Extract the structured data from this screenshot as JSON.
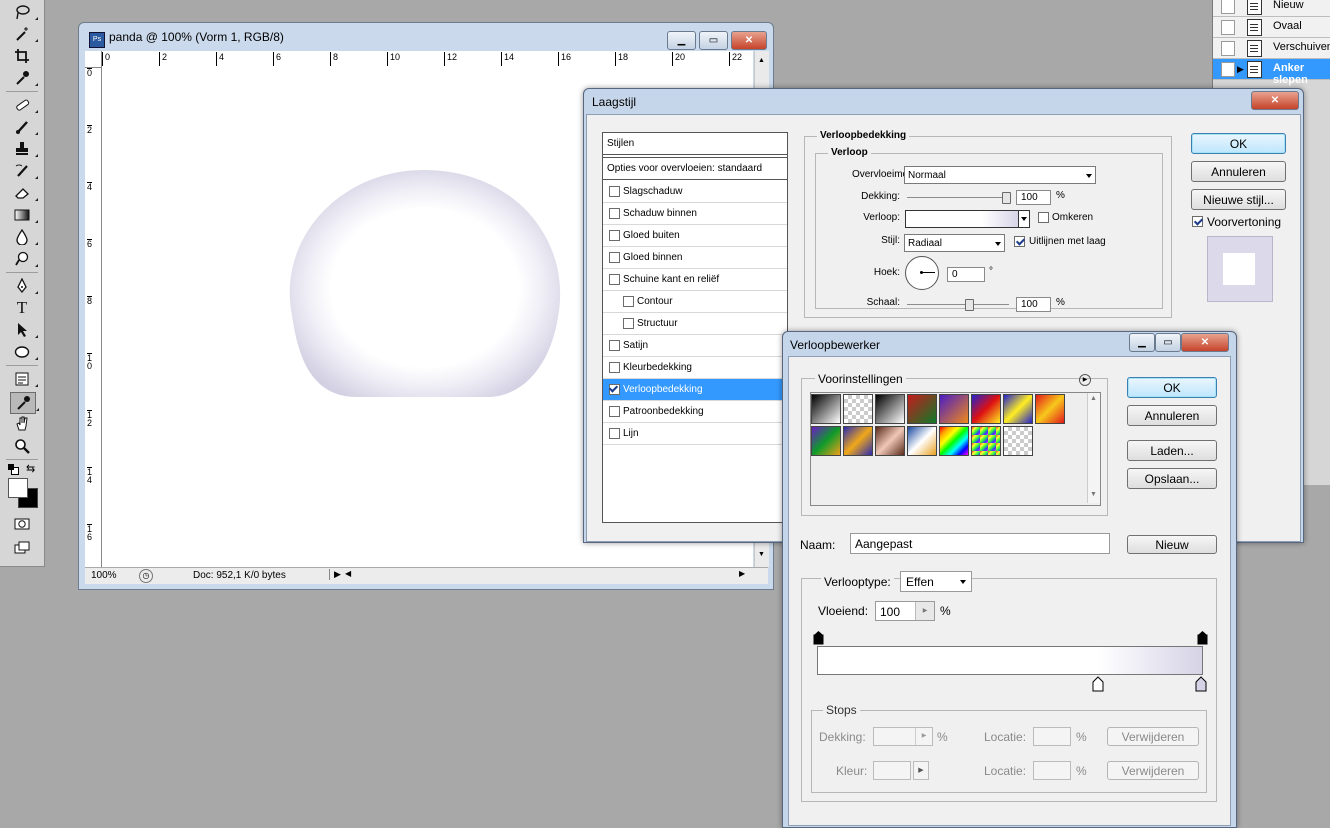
{
  "tools": {
    "icons": [
      "lasso-icon",
      "magic-wand-icon",
      "crop-icon",
      "eyedropper-icon",
      "healing-brush-icon",
      "brush-icon",
      "clone-stamp-icon",
      "history-brush-icon",
      "eraser-icon",
      "gradient-icon",
      "blur-icon",
      "dodge-icon",
      "pen-icon",
      "type-icon",
      "path-selection-icon",
      "ellipse-icon",
      "notes-icon",
      "eyedropper-active-icon",
      "hand-icon",
      "zoom-icon"
    ],
    "type_glyph": "T"
  },
  "history": {
    "items": [
      {
        "label": "Nieuw",
        "selected": false
      },
      {
        "label": "Ovaal",
        "selected": false
      },
      {
        "label": "Verschuiven",
        "selected": false
      },
      {
        "label": "Anker slepen",
        "selected": true
      }
    ]
  },
  "document": {
    "title": "panda @ 100% (Vorm 1, RGB/8)",
    "ruler_top": [
      "0",
      "2",
      "4",
      "6",
      "8",
      "10",
      "12",
      "14",
      "16",
      "18",
      "20",
      "22"
    ],
    "ruler_left": [
      "0",
      "2",
      "4",
      "6",
      "8",
      "1\n0",
      "1\n2",
      "1\n4",
      "1\n6"
    ],
    "zoom": "100%",
    "doc_info": "Doc: 952,1 K/0 bytes"
  },
  "laagstijl": {
    "title": "Laagstijl",
    "styles_header": "Stijlen",
    "blending_options": "Opties voor overvloeien: standaard",
    "styles": [
      {
        "label": "Slagschaduw",
        "checked": false,
        "indent": false,
        "selected": false
      },
      {
        "label": "Schaduw binnen",
        "checked": false,
        "indent": false,
        "selected": false
      },
      {
        "label": "Gloed buiten",
        "checked": false,
        "indent": false,
        "selected": false
      },
      {
        "label": "Gloed binnen",
        "checked": false,
        "indent": false,
        "selected": false
      },
      {
        "label": "Schuine kant en reliëf",
        "checked": false,
        "indent": false,
        "selected": false
      },
      {
        "label": "Contour",
        "checked": false,
        "indent": true,
        "selected": false
      },
      {
        "label": "Structuur",
        "checked": false,
        "indent": true,
        "selected": false
      },
      {
        "label": "Satijn",
        "checked": false,
        "indent": false,
        "selected": false
      },
      {
        "label": "Kleurbedekking",
        "checked": false,
        "indent": false,
        "selected": false
      },
      {
        "label": "Verloopbedekking",
        "checked": true,
        "indent": false,
        "selected": true
      },
      {
        "label": "Patroonbedekking",
        "checked": false,
        "indent": false,
        "selected": false
      },
      {
        "label": "Lijn",
        "checked": false,
        "indent": false,
        "selected": false
      }
    ],
    "section_title": "Verloopbedekking",
    "group_title": "Verloop",
    "blend_mode_label": "Overvloeimodus:",
    "blend_mode_value": "Normaal",
    "opacity_label": "Dekking:",
    "opacity_value": "100",
    "opacity_unit": "%",
    "gradient_label": "Verloop:",
    "reverse_label": "Omkeren",
    "reverse_checked": false,
    "style_label": "Stijl:",
    "style_value": "Radiaal",
    "align_label": "Uitlijnen met laag",
    "align_checked": true,
    "angle_label": "Hoek:",
    "angle_value": "0",
    "angle_unit": "°",
    "scale_label": "Schaal:",
    "scale_value": "100",
    "scale_unit": "%",
    "ok": "OK",
    "cancel": "Annuleren",
    "new_style": "Nieuwe stijl...",
    "preview_label": "Voorvertoning",
    "preview_checked": true
  },
  "verloopbewerker": {
    "title": "Verloopbewerker",
    "presets_label": "Voorinstellingen",
    "ok": "OK",
    "cancel": "Annuleren",
    "load": "Laden...",
    "save": "Opslaan...",
    "name_label": "Naam:",
    "name_value": "Aangepast",
    "new": "Nieuw",
    "type_label": "Verlooptype:",
    "type_value": "Effen",
    "smooth_label": "Vloeiend:",
    "smooth_value": "100",
    "smooth_unit": "%",
    "stops_label": "Stops",
    "opacity_label": "Dekking:",
    "opacity_unit": "%",
    "location_label": "Locatie:",
    "location_unit": "%",
    "color_label": "Kleur:",
    "delete": "Verwijderen"
  },
  "colors": {
    "selection": "#3399ff",
    "gradient_end": "#d6d3e6",
    "panel_bg": "#f0f0f0",
    "dialog_frame": "#c6d6ea"
  }
}
